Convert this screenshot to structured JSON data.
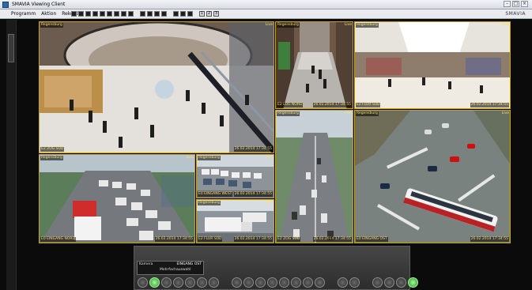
{
  "window": {
    "title": "SMAVIA Viewing Client",
    "brand": "SMAVIA"
  },
  "menu": [
    "Programm",
    "Aktion",
    "Rekorder",
    "?"
  ],
  "toolbar": {
    "page_labels": [
      "1",
      "2",
      "3"
    ]
  },
  "side_tab": {
    "label": "Kameras"
  },
  "cameras": [
    {
      "tag": "Regensburg",
      "status": "Live",
      "caption": "E2 ZOG SÜD",
      "timestamp": "26.02.2014 17:34:55"
    },
    {
      "tag": "Regensburg",
      "status": "Live",
      "caption": "E2 LOG NORD",
      "timestamp": "26.02.2014 17:34:55"
    },
    {
      "tag": "Regensburg",
      "status": "Live",
      "caption": "E2 FLUR SÜD",
      "timestamp": "26.02.2014 17:34:55"
    },
    {
      "tag": "Regensburg",
      "status": "Live",
      "caption": "E2 ZOG SÜD",
      "timestamp": "26.02.2014 17:34:55"
    },
    {
      "tag": "Regensburg",
      "status": "Live",
      "caption": "E0 EINGANG OST",
      "timestamp": "26.02.2014 17:34:55"
    },
    {
      "tag": "Regensburg",
      "status": "Live",
      "caption": "E0 EINGANG NORD",
      "timestamp": "26.02.2014 17:34:55"
    },
    {
      "tag": "Regensburg",
      "status": "Live",
      "caption": "E0 EINGANG WEST",
      "timestamp": "26.02.2014 17:34:55"
    },
    {
      "tag": "Regensburg",
      "status": "Live",
      "caption": "E2 FLUR SÜD",
      "timestamp": "26.02.2014 17:34:55"
    }
  ],
  "console": {
    "camera_label": "Kamera",
    "camera_value": "EINGANG OST",
    "mode_label": "Mehrfachauswahl"
  },
  "colors": {
    "overlay_text": "#ffe066",
    "cell_border": "#c9a400",
    "active_button": "#4cd94c"
  }
}
